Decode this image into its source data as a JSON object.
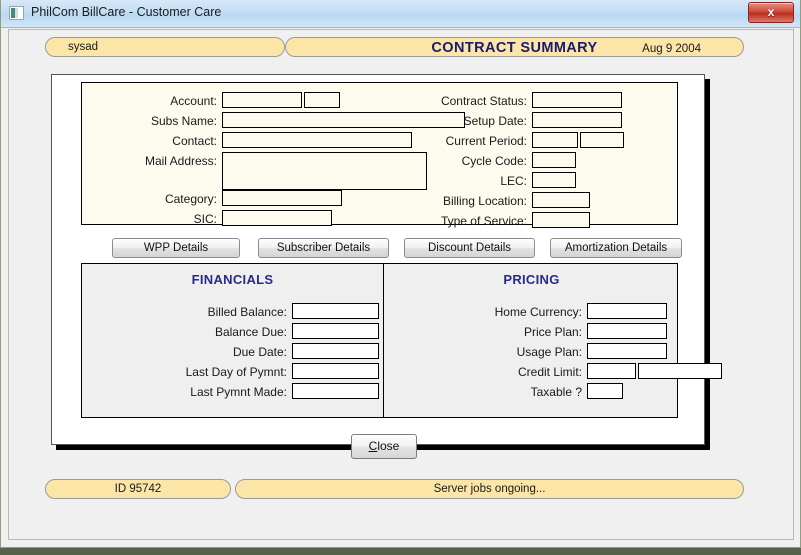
{
  "window": {
    "title": "PhilCom BillCare - Customer Care",
    "icon": "app-window-icon",
    "close_label": "x"
  },
  "header": {
    "user": "sysad",
    "title": "CONTRACT SUMMARY",
    "date": "Aug 9 2004"
  },
  "top_panel": {
    "left_fields": [
      {
        "label": "Account:",
        "value": "",
        "value2": ""
      },
      {
        "label": "Subs Name:",
        "value": ""
      },
      {
        "label": "Contact:",
        "value": ""
      },
      {
        "label": "Mail Address:",
        "value": ""
      },
      {
        "label": "Category:",
        "value": ""
      },
      {
        "label": "SIC:",
        "value": ""
      }
    ],
    "right_fields": [
      {
        "label": "Contract Status:",
        "value": ""
      },
      {
        "label": "Setup Date:",
        "value": ""
      },
      {
        "label": "Current Period:",
        "value": "",
        "value2": ""
      },
      {
        "label": "Cycle Code:",
        "value": ""
      },
      {
        "label": "LEC:",
        "value": ""
      },
      {
        "label": "Billing Location:",
        "value": ""
      },
      {
        "label": "Type of Service:",
        "value": ""
      }
    ]
  },
  "detail_buttons": [
    {
      "label": "WPP Details"
    },
    {
      "label": "Subscriber Details"
    },
    {
      "label": "Discount Details"
    },
    {
      "label": "Amortization Details"
    }
  ],
  "financials": {
    "title": "FINANCIALS",
    "fields": [
      {
        "label": "Billed Balance:",
        "value": ""
      },
      {
        "label": "Balance Due:",
        "value": ""
      },
      {
        "label": "Due Date:",
        "value": ""
      },
      {
        "label": "Last Day of Pymnt:",
        "value": ""
      },
      {
        "label": "Last Pymnt Made:",
        "value": ""
      }
    ]
  },
  "pricing": {
    "title": "PRICING",
    "fields": [
      {
        "label": "Home Currency:",
        "value": ""
      },
      {
        "label": "Price Plan:",
        "value": ""
      },
      {
        "label": "Usage Plan:",
        "value": ""
      },
      {
        "label": "Credit Limit:",
        "value": "",
        "value2": ""
      },
      {
        "label": "Taxable ?",
        "value": ""
      }
    ]
  },
  "actions": {
    "close_label": "Close",
    "close_accel": "C",
    "close_rest": "lose"
  },
  "footer": {
    "id": "ID 95742",
    "status": "Server jobs ongoing..."
  },
  "colors": {
    "pill_fill": "#fbe6a8",
    "title_blue": "#1a1a6e",
    "section_blue": "#2a2a8c",
    "panel_cream": "#fdfaee",
    "panel_grey": "#efefef",
    "titlebar_blue": "#c2def5",
    "close_red": "#cf4b3b"
  }
}
